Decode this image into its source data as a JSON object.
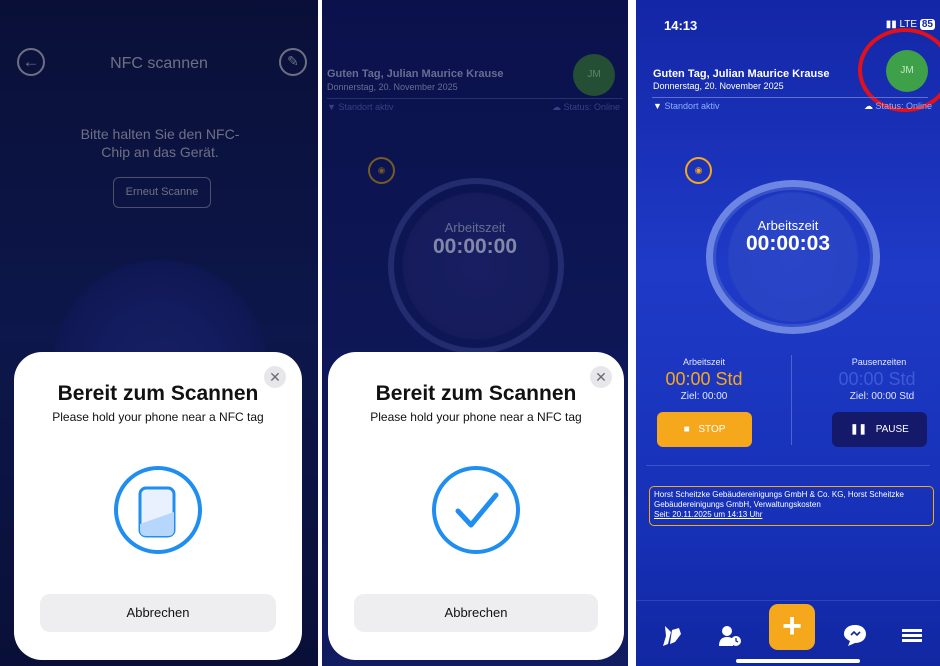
{
  "panel1": {
    "header_title": "NFC scannen",
    "instruction": "Bitte halten Sie den NFC-Chip an das Gerät.",
    "rescan_label": "Erneut Scanne",
    "sheet": {
      "title": "Bereit zum Scannen",
      "subtitle": "Please hold your phone near a NFC tag",
      "cancel_label": "Abbrechen",
      "close_icon": "close-icon",
      "status_icon": "phone-icon"
    }
  },
  "panel2": {
    "greeting": "Guten Tag, Julian Maurice Krause",
    "date": "Donnerstag, 20. November 2025",
    "avatar_initials": "JM",
    "location": "Standort aktiv",
    "status": "Status: Online",
    "timer_label": "Arbeitszeit",
    "timer_value": "00:00:00",
    "sheet": {
      "title": "Bereit zum Scannen",
      "subtitle": "Please hold your phone near a NFC tag",
      "cancel_label": "Abbrechen",
      "status_icon": "checkmark-icon"
    }
  },
  "panel3": {
    "status_bar": {
      "time": "14:13",
      "network": "LTE",
      "battery": "85"
    },
    "greeting": "Guten Tag, Julian Maurice Krause",
    "date": "Donnerstag, 20. November 2025",
    "avatar_initials": "JM",
    "location": "Standort aktiv",
    "status": "Status: Online",
    "timer_label": "Arbeitszeit",
    "timer_value": "00:00:03",
    "work": {
      "label": "Arbeitszeit",
      "value": "00:00 Std",
      "goal": "Ziel: 00:00",
      "button": "STOP"
    },
    "pause": {
      "label": "Pausenzeiten",
      "value": "00:00 Std",
      "goal": "Ziel: 00:00 Std",
      "button": "PAUSE"
    },
    "assignment": {
      "text": "Horst Scheitzke Gebäudereinigungs GmbH & Co. KG, Horst Scheitzke Gebäudereinigungs GmbH, Verwaltungskosten",
      "since": "Seit: 20.11.2025 um 14:13 Uhr"
    },
    "colors": {
      "accent": "#f6a81c",
      "avatar": "#3fa04a",
      "highlight": "#e0111a"
    }
  }
}
